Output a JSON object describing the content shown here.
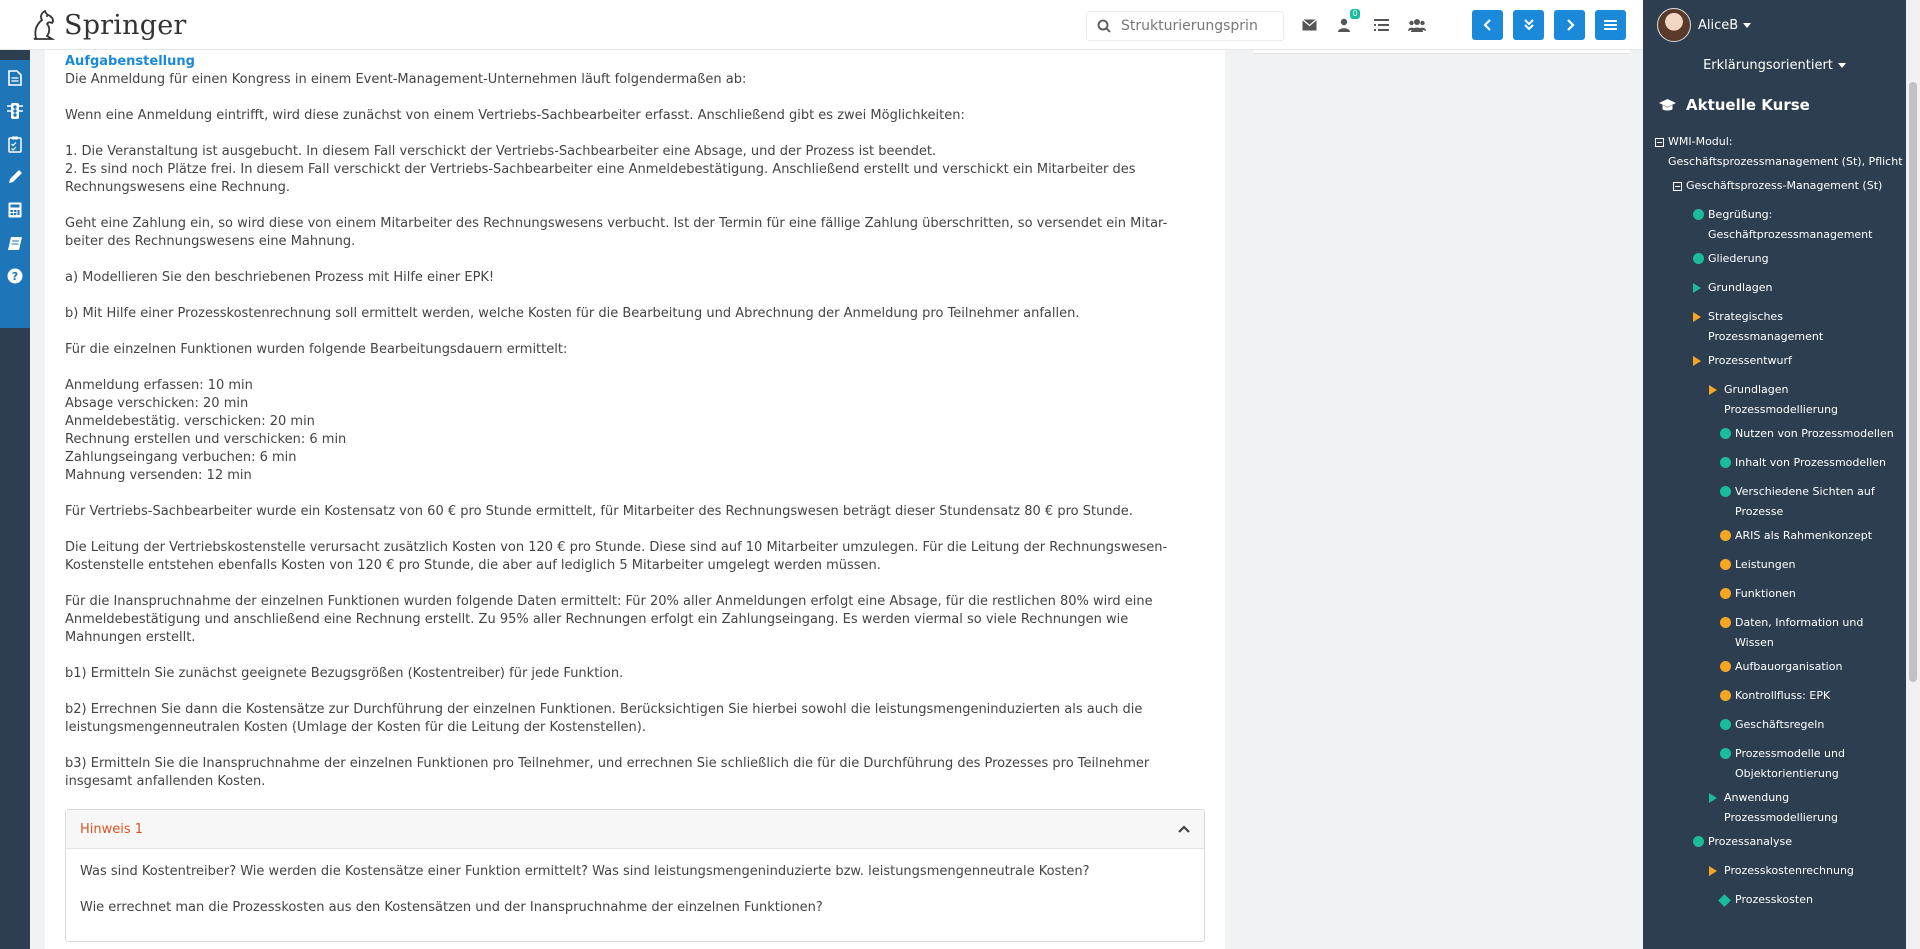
{
  "header": {
    "logo_text": "Springer",
    "search": {
      "placeholder": "Strukturierungsprin",
      "value": ""
    },
    "icons": [
      "envelope-icon",
      "user-badge-icon",
      "list-icon",
      "users-icon"
    ],
    "badge_count": "0",
    "nav_buttons": [
      "chevron-left-icon",
      "double-chevron-down-icon",
      "chevron-right-icon",
      "menu-icon"
    ]
  },
  "left_rail": {
    "icons": [
      "document-icon",
      "traffic-light-icon",
      "checklist-icon",
      "pencil-icon",
      "calculator-icon",
      "book-icon",
      "help-icon"
    ]
  },
  "content": {
    "section_title": "Aufgabenstellung",
    "paragraphs": [
      "Die Anmeldung für einen Kongress in einem Event-Management-Unternehmen läuft folgendermaßen ab:",
      "Wenn eine Anmeldung eintrifft, wird diese zunächst von einem Vertriebs-Sachbearbeiter erfasst. Anschließend gibt es zwei Möglichkeiten:",
      "1. Die Veranstaltung ist ausgebucht. In diesem Fall verschickt der Vertriebs-Sachbearbeiter eine Absage, und der Prozess ist beendet.\n2. Es sind noch Plätze frei. In diesem Fall verschickt der Vertriebs-Sachbearbeiter eine Anmeldebestätigung. Anschließend erstellt und verschickt ein Mitarbeiter des\nRechnungswesens eine Rechnung.",
      "Geht eine Zahlung ein, so wird diese von einem Mitarbeiter des Rechnungswesens verbucht. Ist der Termin für eine fällige Zahlung überschritten, so versendet ein Mitar-\nbeiter des Rechnungswesens eine Mahnung.",
      "a) Modellieren Sie den beschriebenen Prozess mit Hilfe einer EPK!",
      "b) Mit Hilfe einer Prozesskostenrechnung soll ermittelt werden, welche Kosten für die Bearbeitung und Abrechnung der Anmeldung pro Teilnehmer anfallen.",
      "Für die einzelnen Funktionen wurden folgende Bearbeitungsdauern ermittelt:",
      "Anmeldung erfassen: 10 min\nAbsage verschicken: 20 min\nAnmeldebestätig. verschicken: 20 min\nRechnung erstellen und verschicken: 6 min\nZahlungseingang verbuchen: 6 min\nMahnung versenden: 12 min",
      "Für Vertriebs-Sachbearbeiter wurde ein Kostensatz von 60 € pro Stunde ermittelt, für Mitarbeiter des Rechnungswesen beträgt dieser Stundensatz 80 € pro Stunde.",
      "Die Leitung der Vertriebskostenstelle verursacht zusätzlich Kosten von 120 € pro Stunde. Diese sind auf 10 Mitarbeiter umzulegen. Für die Leitung der Rechnungswesen-\nKostenstelle entstehen ebenfalls Kosten von 120 € pro Stunde, die aber auf lediglich 5 Mitarbeiter umgelegt werden müssen.",
      "Für die Inanspruchnahme der einzelnen Funktionen wurden folgende Daten ermittelt: Für 20% aller Anmeldungen erfolgt eine Absage, für die restlichen 80% wird eine\nAnmeldebestätigung und anschließend eine Rechnung erstellt. Zu 95% aller Rechnungen erfolgt ein Zahlungseingang. Es werden viermal so viele Rechnungen wie\nMahnungen erstellt.",
      "b1) Ermitteln Sie zunächst geeignete Bezugsgrößen (Kostentreiber) für jede Funktion.",
      "b2) Errechnen Sie dann die Kostensätze zur Durchführung der einzelnen Funktionen. Berücksichtigen Sie hierbei sowohl die leistungsmengeninduzierten als auch die\nleistungsmengenneutralen Kosten (Umlage der Kosten für die Leitung der Kostenstellen).",
      "b3) Ermitteln Sie die Inanspruchnahme der einzelnen Funktionen pro Teilnehmer, und errechnen Sie schließlich die für die Durchführung des Prozesses pro Teilnehmer\ninsgesamt anfallenden Kosten."
    ],
    "hint": {
      "title": "Hinweis 1",
      "lines": [
        "Was sind Kostentreiber? Wie werden die Kostensätze einer Funktion ermittelt? Was sind leistungsmengeninduzierte bzw. leistungsmengenneutrale Kosten?",
        "Wie errechnet man die Prozesskosten aus den Kostensätzen und der Inanspruchnahme der einzelnen Funktionen?"
      ]
    }
  },
  "sidebar": {
    "username": "AliceB",
    "mode": "Erklärungsorientiert",
    "courses_title": "Aktuelle Kurse",
    "tree": [
      {
        "label": "WMI-Modul:\nGeschäftsprozessmanagement (St), Pflicht",
        "marker": "box-minus",
        "color": ""
      },
      {
        "label": "Geschäftsprozess-Management (St)",
        "marker": "box-minus",
        "color": ""
      },
      {
        "label": "Begrüßung:\nGeschäftprozessmanagement",
        "marker": "dot",
        "color": "#1abc9c"
      },
      {
        "label": "Gliederung",
        "marker": "dot",
        "color": "#1abc9c"
      },
      {
        "label": "Grundlagen",
        "marker": "triangle",
        "color": "#1abc9c"
      },
      {
        "label": "Strategisches\nProzessmanagement",
        "marker": "triangle",
        "color": "#f5a623"
      },
      {
        "label": "Prozessentwurf",
        "marker": "triangle",
        "color": "#f5a623"
      },
      {
        "label": "Grundlagen\nProzessmodellierung",
        "marker": "triangle",
        "color": "#f5a623"
      },
      {
        "label": "Nutzen von Prozessmodellen",
        "marker": "dot",
        "color": "#1abc9c"
      },
      {
        "label": "Inhalt von Prozessmodellen",
        "marker": "dot",
        "color": "#1abc9c"
      },
      {
        "label": "Verschiedene Sichten auf\nProzesse",
        "marker": "dot",
        "color": "#1abc9c"
      },
      {
        "label": "ARIS als Rahmenkonzept",
        "marker": "dot",
        "color": "#f5a623"
      },
      {
        "label": "Leistungen",
        "marker": "dot",
        "color": "#f5a623"
      },
      {
        "label": "Funktionen",
        "marker": "dot",
        "color": "#f5a623"
      },
      {
        "label": "Daten, Information und\nWissen",
        "marker": "dot",
        "color": "#f5a623"
      },
      {
        "label": "Aufbauorganisation",
        "marker": "dot",
        "color": "#f5a623"
      },
      {
        "label": "Kontrollfluss: EPK",
        "marker": "dot",
        "color": "#f5a623"
      },
      {
        "label": "Geschäftsregeln",
        "marker": "dot",
        "color": "#1abc9c"
      },
      {
        "label": "Prozessmodelle und\nObjektorientierung",
        "marker": "dot",
        "color": "#1abc9c"
      },
      {
        "label": "Anwendung\nProzessmodellierung",
        "marker": "triangle",
        "color": "#1abc9c"
      },
      {
        "label": "Prozessanalyse",
        "marker": "dot",
        "color": "#1abc9c"
      },
      {
        "label": "Prozesskostenrechnung",
        "marker": "triangle",
        "color": "#f5a623"
      },
      {
        "label": "Prozesskosten",
        "marker": "diamond",
        "color": "#1abc9c"
      }
    ]
  },
  "colors": {
    "accent": "#1a89d9",
    "sidebar_bg": "#2c3e50",
    "hint_title": "#d9541e",
    "status_done": "#1abc9c",
    "status_open": "#f5a623"
  }
}
